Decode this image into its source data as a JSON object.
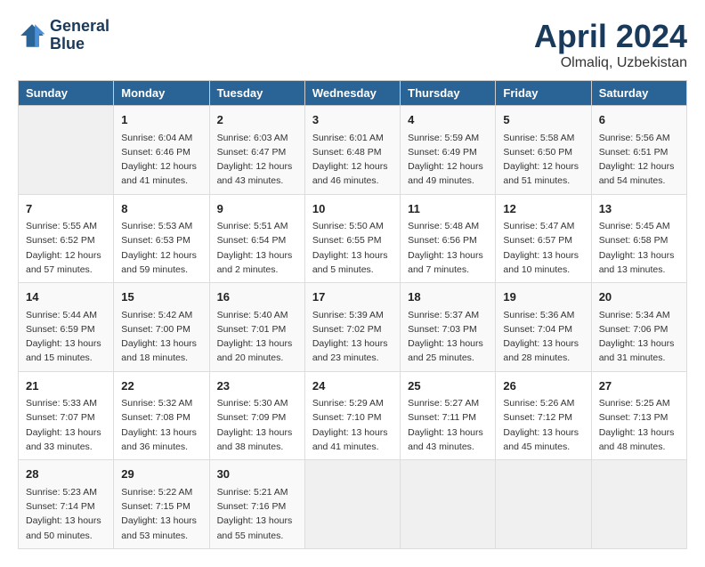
{
  "header": {
    "logo_line1": "General",
    "logo_line2": "Blue",
    "month": "April 2024",
    "location": "Olmaliq, Uzbekistan"
  },
  "days_of_week": [
    "Sunday",
    "Monday",
    "Tuesday",
    "Wednesday",
    "Thursday",
    "Friday",
    "Saturday"
  ],
  "weeks": [
    [
      {
        "num": "",
        "info": ""
      },
      {
        "num": "1",
        "info": "Sunrise: 6:04 AM\nSunset: 6:46 PM\nDaylight: 12 hours\nand 41 minutes."
      },
      {
        "num": "2",
        "info": "Sunrise: 6:03 AM\nSunset: 6:47 PM\nDaylight: 12 hours\nand 43 minutes."
      },
      {
        "num": "3",
        "info": "Sunrise: 6:01 AM\nSunset: 6:48 PM\nDaylight: 12 hours\nand 46 minutes."
      },
      {
        "num": "4",
        "info": "Sunrise: 5:59 AM\nSunset: 6:49 PM\nDaylight: 12 hours\nand 49 minutes."
      },
      {
        "num": "5",
        "info": "Sunrise: 5:58 AM\nSunset: 6:50 PM\nDaylight: 12 hours\nand 51 minutes."
      },
      {
        "num": "6",
        "info": "Sunrise: 5:56 AM\nSunset: 6:51 PM\nDaylight: 12 hours\nand 54 minutes."
      }
    ],
    [
      {
        "num": "7",
        "info": "Sunrise: 5:55 AM\nSunset: 6:52 PM\nDaylight: 12 hours\nand 57 minutes."
      },
      {
        "num": "8",
        "info": "Sunrise: 5:53 AM\nSunset: 6:53 PM\nDaylight: 12 hours\nand 59 minutes."
      },
      {
        "num": "9",
        "info": "Sunrise: 5:51 AM\nSunset: 6:54 PM\nDaylight: 13 hours\nand 2 minutes."
      },
      {
        "num": "10",
        "info": "Sunrise: 5:50 AM\nSunset: 6:55 PM\nDaylight: 13 hours\nand 5 minutes."
      },
      {
        "num": "11",
        "info": "Sunrise: 5:48 AM\nSunset: 6:56 PM\nDaylight: 13 hours\nand 7 minutes."
      },
      {
        "num": "12",
        "info": "Sunrise: 5:47 AM\nSunset: 6:57 PM\nDaylight: 13 hours\nand 10 minutes."
      },
      {
        "num": "13",
        "info": "Sunrise: 5:45 AM\nSunset: 6:58 PM\nDaylight: 13 hours\nand 13 minutes."
      }
    ],
    [
      {
        "num": "14",
        "info": "Sunrise: 5:44 AM\nSunset: 6:59 PM\nDaylight: 13 hours\nand 15 minutes."
      },
      {
        "num": "15",
        "info": "Sunrise: 5:42 AM\nSunset: 7:00 PM\nDaylight: 13 hours\nand 18 minutes."
      },
      {
        "num": "16",
        "info": "Sunrise: 5:40 AM\nSunset: 7:01 PM\nDaylight: 13 hours\nand 20 minutes."
      },
      {
        "num": "17",
        "info": "Sunrise: 5:39 AM\nSunset: 7:02 PM\nDaylight: 13 hours\nand 23 minutes."
      },
      {
        "num": "18",
        "info": "Sunrise: 5:37 AM\nSunset: 7:03 PM\nDaylight: 13 hours\nand 25 minutes."
      },
      {
        "num": "19",
        "info": "Sunrise: 5:36 AM\nSunset: 7:04 PM\nDaylight: 13 hours\nand 28 minutes."
      },
      {
        "num": "20",
        "info": "Sunrise: 5:34 AM\nSunset: 7:06 PM\nDaylight: 13 hours\nand 31 minutes."
      }
    ],
    [
      {
        "num": "21",
        "info": "Sunrise: 5:33 AM\nSunset: 7:07 PM\nDaylight: 13 hours\nand 33 minutes."
      },
      {
        "num": "22",
        "info": "Sunrise: 5:32 AM\nSunset: 7:08 PM\nDaylight: 13 hours\nand 36 minutes."
      },
      {
        "num": "23",
        "info": "Sunrise: 5:30 AM\nSunset: 7:09 PM\nDaylight: 13 hours\nand 38 minutes."
      },
      {
        "num": "24",
        "info": "Sunrise: 5:29 AM\nSunset: 7:10 PM\nDaylight: 13 hours\nand 41 minutes."
      },
      {
        "num": "25",
        "info": "Sunrise: 5:27 AM\nSunset: 7:11 PM\nDaylight: 13 hours\nand 43 minutes."
      },
      {
        "num": "26",
        "info": "Sunrise: 5:26 AM\nSunset: 7:12 PM\nDaylight: 13 hours\nand 45 minutes."
      },
      {
        "num": "27",
        "info": "Sunrise: 5:25 AM\nSunset: 7:13 PM\nDaylight: 13 hours\nand 48 minutes."
      }
    ],
    [
      {
        "num": "28",
        "info": "Sunrise: 5:23 AM\nSunset: 7:14 PM\nDaylight: 13 hours\nand 50 minutes."
      },
      {
        "num": "29",
        "info": "Sunrise: 5:22 AM\nSunset: 7:15 PM\nDaylight: 13 hours\nand 53 minutes."
      },
      {
        "num": "30",
        "info": "Sunrise: 5:21 AM\nSunset: 7:16 PM\nDaylight: 13 hours\nand 55 minutes."
      },
      {
        "num": "",
        "info": ""
      },
      {
        "num": "",
        "info": ""
      },
      {
        "num": "",
        "info": ""
      },
      {
        "num": "",
        "info": ""
      }
    ]
  ]
}
